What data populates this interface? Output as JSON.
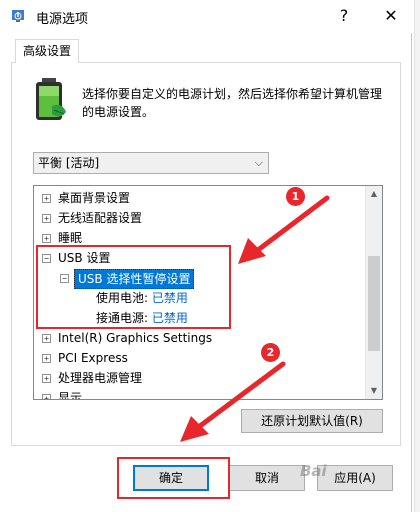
{
  "window": {
    "title": "电源选项",
    "help_glyph": "?",
    "close_glyph": "✕"
  },
  "tab": {
    "label": "高级设置"
  },
  "description": "选择你要自定义的电源计划，然后选择你希望计算机管理的电源设置。",
  "plan_select": {
    "value": "平衡 [活动]"
  },
  "tree": {
    "items": [
      {
        "label": "桌面背景设置",
        "expander": "+"
      },
      {
        "label": "无线适配器设置",
        "expander": "+"
      },
      {
        "label": "睡眠",
        "expander": "+"
      },
      {
        "label": "USB 设置",
        "expander": "−"
      },
      {
        "label": "USB 选择性暂停设置",
        "expander": "−"
      },
      {
        "label": "使用电池:",
        "value": "已禁用"
      },
      {
        "label": "接通电源:",
        "value": "已禁用"
      },
      {
        "label": "Intel(R) Graphics Settings",
        "expander": "+"
      },
      {
        "label": "PCI Express",
        "expander": "+"
      },
      {
        "label": "处理器电源管理",
        "expander": "+"
      },
      {
        "label": "显示",
        "expander": "+"
      }
    ]
  },
  "buttons": {
    "restore_defaults": "还原计划默认值(R)",
    "ok": "确定",
    "cancel": "取消",
    "apply": "应用(A)"
  },
  "annotations": {
    "callout_1": "1",
    "callout_2": "2",
    "color": "#e8272d"
  },
  "watermark": "Bai"
}
